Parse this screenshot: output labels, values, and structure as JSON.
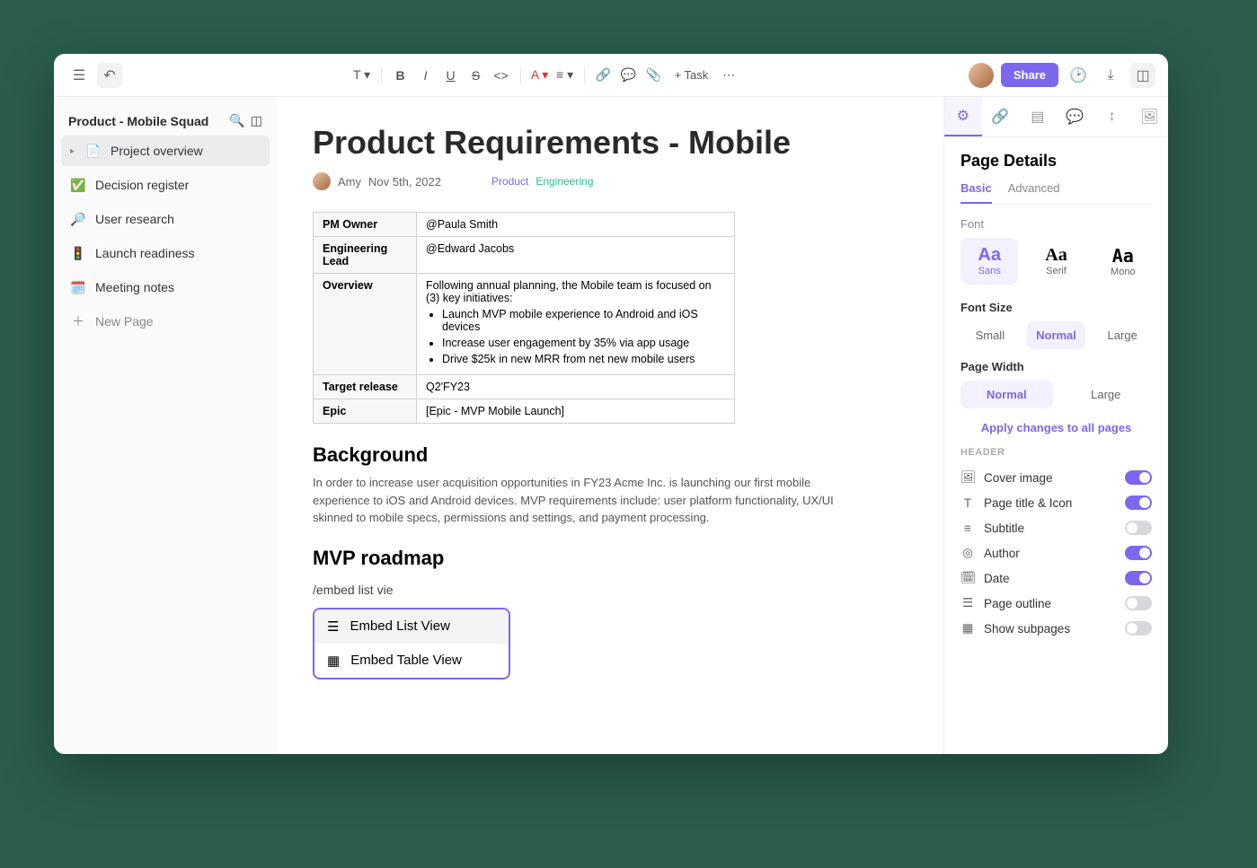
{
  "topbar": {
    "task_label": "+ Task",
    "share_label": "Share"
  },
  "sidebar": {
    "space_title": "Product - Mobile Squad",
    "items": [
      {
        "icon": "📄",
        "label": "Project overview"
      },
      {
        "icon": "✅",
        "label": "Decision register"
      },
      {
        "icon": "🔎",
        "label": "User research"
      },
      {
        "icon": "🚦",
        "label": "Launch readiness"
      },
      {
        "icon": "🗓️",
        "label": "Meeting notes"
      }
    ],
    "new_page": "New Page"
  },
  "doc": {
    "title": "Product Requirements - Mobile",
    "author": "Amy",
    "date": "Nov 5th, 2022",
    "tags": {
      "product": "Product",
      "engineering": "Engineering"
    },
    "table": {
      "rows": [
        {
          "label": "PM Owner",
          "value": "@Paula Smith"
        },
        {
          "label": "Engineering Lead",
          "value": "@Edward Jacobs"
        },
        {
          "label": "Overview",
          "value": "Following annual planning, the Mobile team is focused on (3) key initiatives:",
          "bullets": [
            "Launch MVP mobile experience to Android and iOS devices",
            "Increase user engagement by 35% via app usage",
            "Drive $25k in new MRR from net new mobile users"
          ]
        },
        {
          "label": "Target release",
          "value": "Q2'FY23"
        },
        {
          "label": "Epic",
          "value": "[Epic - MVP Mobile Launch]"
        }
      ]
    },
    "background": {
      "heading": "Background",
      "body": "In order to increase user acquisition opportunities in FY23 Acme Inc. is launching our first mobile experience to iOS and Android devices. MVP requirements include: user platform functionality, UX/UI skinned to mobile specs, permissions and settings, and payment processing."
    },
    "roadmap": {
      "heading": "MVP roadmap"
    },
    "slash_command": "/embed list vie",
    "embed_menu": {
      "items": [
        {
          "label": "Embed List View"
        },
        {
          "label": "Embed Table View"
        }
      ]
    }
  },
  "rpanel": {
    "title": "Page Details",
    "sub_tabs": {
      "basic": "Basic",
      "advanced": "Advanced"
    },
    "font": {
      "label": "Font",
      "options": {
        "sans": "Sans",
        "serif": "Serif",
        "mono": "Mono"
      }
    },
    "font_size": {
      "label": "Font Size",
      "options": {
        "small": "Small",
        "normal": "Normal",
        "large": "Large"
      }
    },
    "page_width": {
      "label": "Page Width",
      "options": {
        "normal": "Normal",
        "large": "Large"
      }
    },
    "apply_all": "Apply changes to all pages",
    "header_section": "HEADER",
    "toggles": [
      {
        "icon": "🖼",
        "label": "Cover image",
        "on": true
      },
      {
        "icon": "T",
        "label": "Page title & Icon",
        "on": true
      },
      {
        "icon": "≡",
        "label": "Subtitle",
        "on": false
      },
      {
        "icon": "◎",
        "label": "Author",
        "on": true
      },
      {
        "icon": "🗓",
        "label": "Date",
        "on": true
      },
      {
        "icon": "☰",
        "label": "Page outline",
        "on": false
      },
      {
        "icon": "▦",
        "label": "Show subpages",
        "on": false
      }
    ]
  }
}
